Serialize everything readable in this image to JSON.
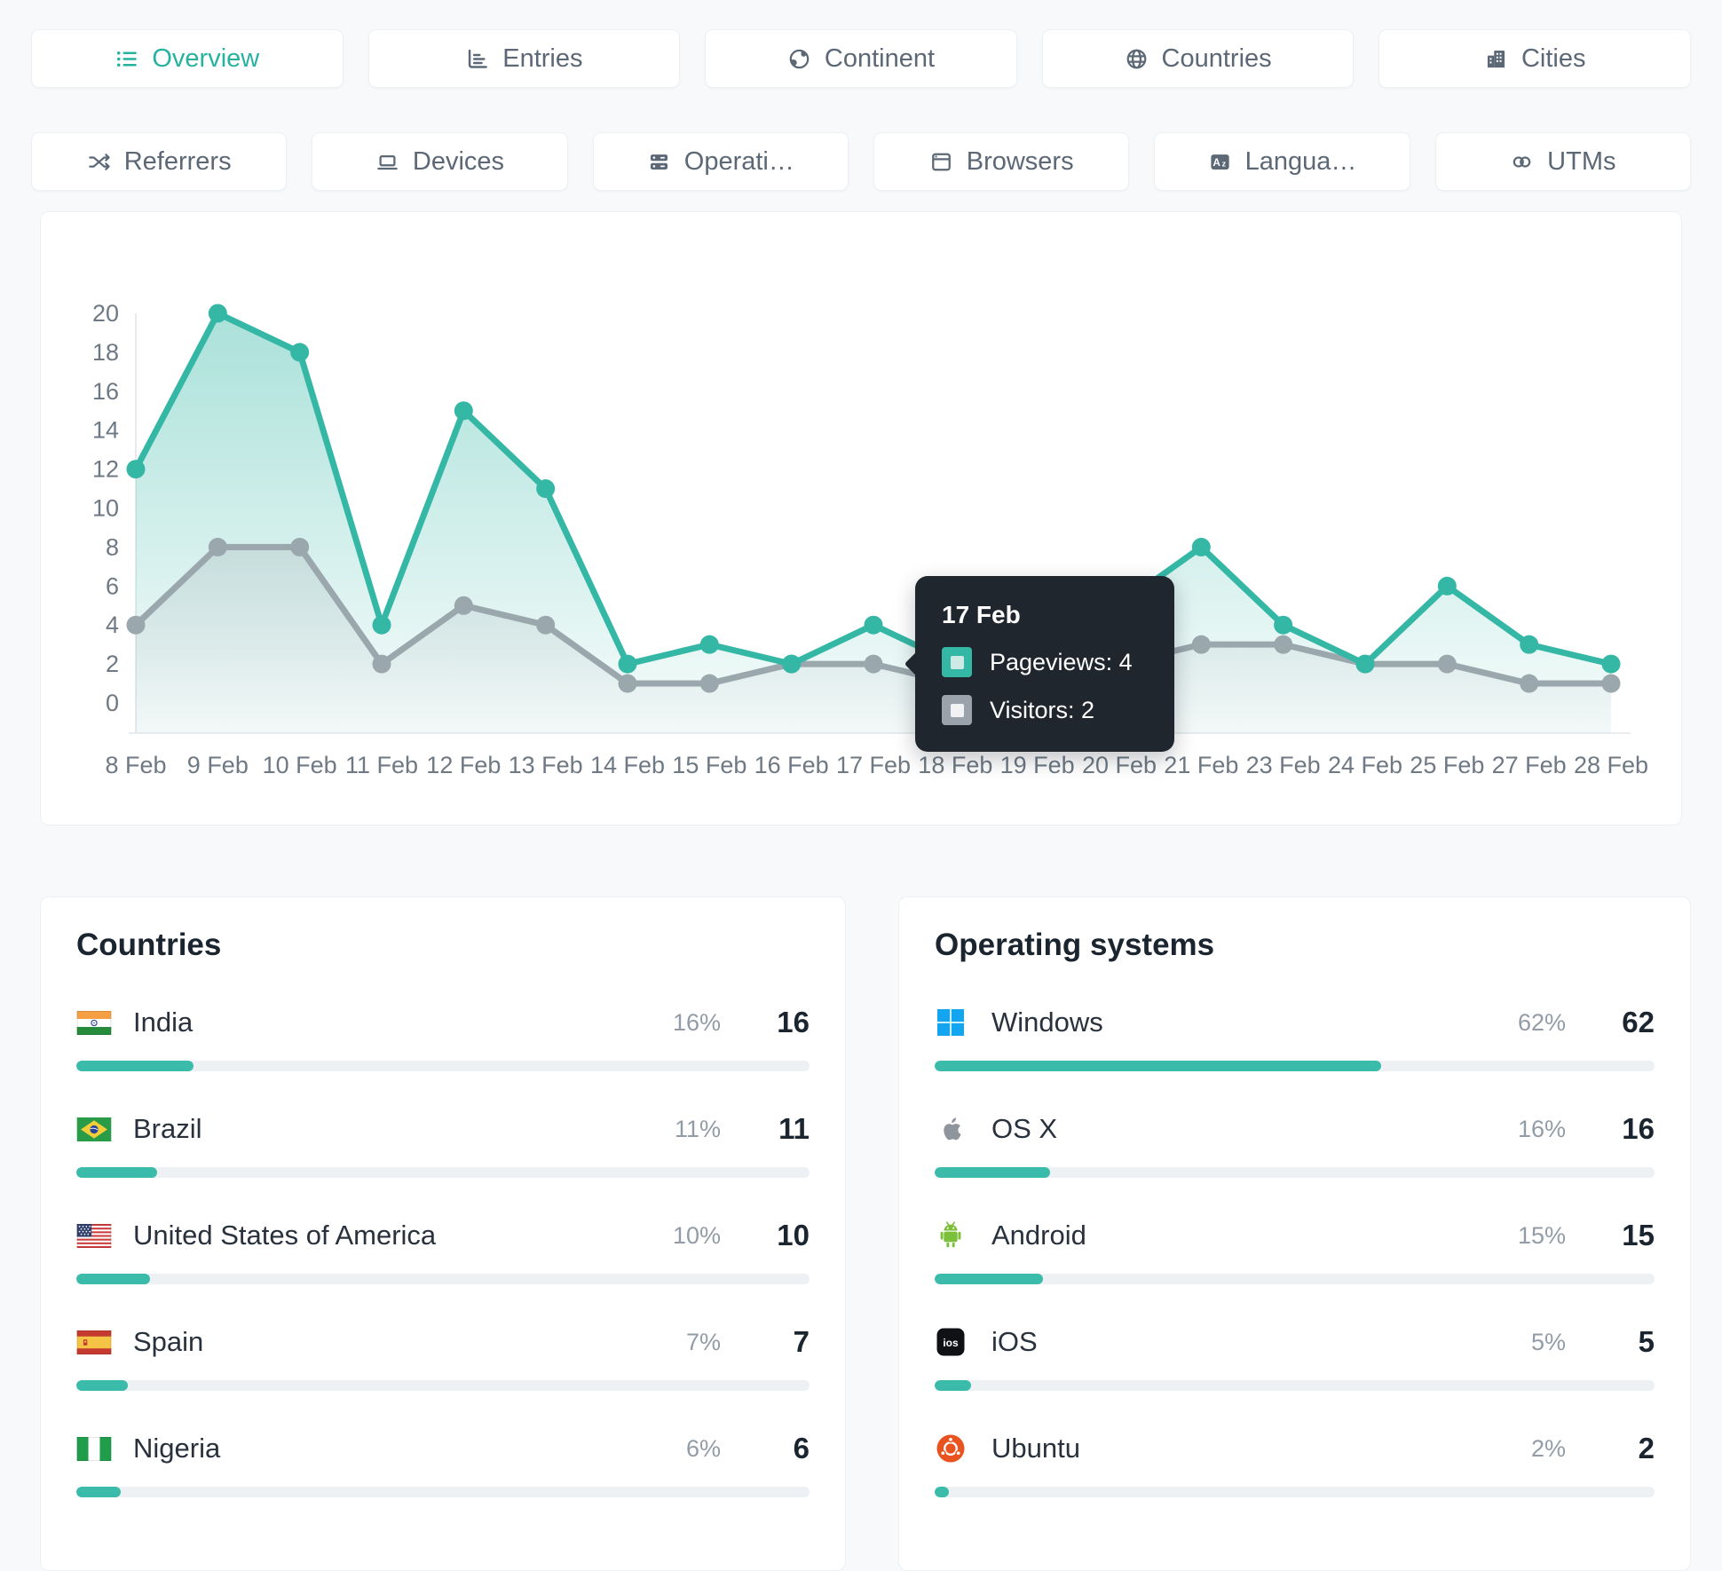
{
  "colors": {
    "accent": "#27b2a0",
    "pageviews": "#35b7a6",
    "visitors": "#9aa7ad",
    "bar_fill": "#3bbcab",
    "bar_track": "#eef1f3",
    "tooltip_bg": "#20262d",
    "windows_blue": "#13a5f0",
    "android_green": "#7bbf3a",
    "ubuntu_orange": "#e9531f"
  },
  "tabs_row1": [
    {
      "id": "overview",
      "label": "Overview",
      "icon": "icon-list",
      "active": true
    },
    {
      "id": "entries",
      "label": "Entries",
      "icon": "icon-entries",
      "active": false
    },
    {
      "id": "continent",
      "label": "Continent",
      "icon": "icon-continent",
      "active": false
    },
    {
      "id": "countries",
      "label": "Countries",
      "icon": "icon-globe",
      "active": false
    },
    {
      "id": "cities",
      "label": "Cities",
      "icon": "icon-city",
      "active": false
    }
  ],
  "tabs_row2": [
    {
      "id": "referrers",
      "label": "Referrers",
      "icon": "icon-shuffle",
      "active": false
    },
    {
      "id": "devices",
      "label": "Devices",
      "icon": "icon-laptop",
      "active": false
    },
    {
      "id": "operating-systems",
      "label": "Operati…",
      "icon": "icon-server",
      "active": false
    },
    {
      "id": "browsers",
      "label": "Browsers",
      "icon": "icon-browser",
      "active": false
    },
    {
      "id": "languages",
      "label": "Langua…",
      "icon": "icon-translate",
      "active": false
    },
    {
      "id": "utms",
      "label": "UTMs",
      "icon": "icon-link",
      "active": false
    }
  ],
  "chart_data": {
    "type": "line",
    "categories": [
      "8 Feb",
      "9 Feb",
      "10 Feb",
      "11 Feb",
      "12 Feb",
      "13 Feb",
      "14 Feb",
      "15 Feb",
      "16 Feb",
      "17 Feb",
      "18 Feb",
      "19 Feb",
      "20 Feb",
      "21 Feb",
      "23 Feb",
      "24 Feb",
      "25 Feb",
      "27 Feb",
      "28 Feb"
    ],
    "series": [
      {
        "name": "Pageviews",
        "color": "#35b7a6",
        "values": [
          12,
          20,
          18,
          4,
          15,
          11,
          2,
          3,
          2,
          4,
          2,
          2,
          5,
          8,
          4,
          2,
          6,
          3,
          2
        ]
      },
      {
        "name": "Visitors",
        "color": "#9aa7ad",
        "values": [
          4,
          8,
          8,
          2,
          5,
          4,
          1,
          1,
          2,
          2,
          1,
          1,
          2,
          3,
          3,
          2,
          2,
          1,
          1
        ]
      }
    ],
    "ylim": [
      0,
      20
    ],
    "y_ticks": [
      0,
      2,
      4,
      6,
      8,
      10,
      12,
      14,
      16,
      18,
      20
    ],
    "grid": "none",
    "legend": "none",
    "occluded_categories": [
      "18 Feb",
      "19 Feb",
      "20 Feb"
    ]
  },
  "tooltip": {
    "title": "17 Feb",
    "rows": [
      {
        "label": "Pageviews",
        "value": "4",
        "swatch": "#35b7a6",
        "swatch_inner": "#cdeae4"
      },
      {
        "label": "Visitors",
        "value": "2",
        "swatch": "#9aa3ab",
        "swatch_inner": "#f0f2f3"
      }
    ]
  },
  "countries_panel": {
    "title": "Countries",
    "rows": [
      {
        "name": "India",
        "icon": "flag-india",
        "percent": "16%",
        "count": "16",
        "bar": 16
      },
      {
        "name": "Brazil",
        "icon": "flag-brazil",
        "percent": "11%",
        "count": "11",
        "bar": 11
      },
      {
        "name": "United States of America",
        "icon": "flag-usa",
        "percent": "10%",
        "count": "10",
        "bar": 10
      },
      {
        "name": "Spain",
        "icon": "flag-spain",
        "percent": "7%",
        "count": "7",
        "bar": 7
      },
      {
        "name": "Nigeria",
        "icon": "flag-nigeria",
        "percent": "6%",
        "count": "6",
        "bar": 6
      }
    ]
  },
  "os_panel": {
    "title": "Operating systems",
    "rows": [
      {
        "name": "Windows",
        "icon": "logo-windows",
        "percent": "62%",
        "count": "62",
        "bar": 62
      },
      {
        "name": "OS X",
        "icon": "logo-apple",
        "percent": "16%",
        "count": "16",
        "bar": 16
      },
      {
        "name": "Android",
        "icon": "logo-android",
        "percent": "15%",
        "count": "15",
        "bar": 15
      },
      {
        "name": "iOS",
        "icon": "logo-ios",
        "percent": "5%",
        "count": "5",
        "bar": 5
      },
      {
        "name": "Ubuntu",
        "icon": "logo-ubuntu",
        "percent": "2%",
        "count": "2",
        "bar": 2
      }
    ]
  }
}
